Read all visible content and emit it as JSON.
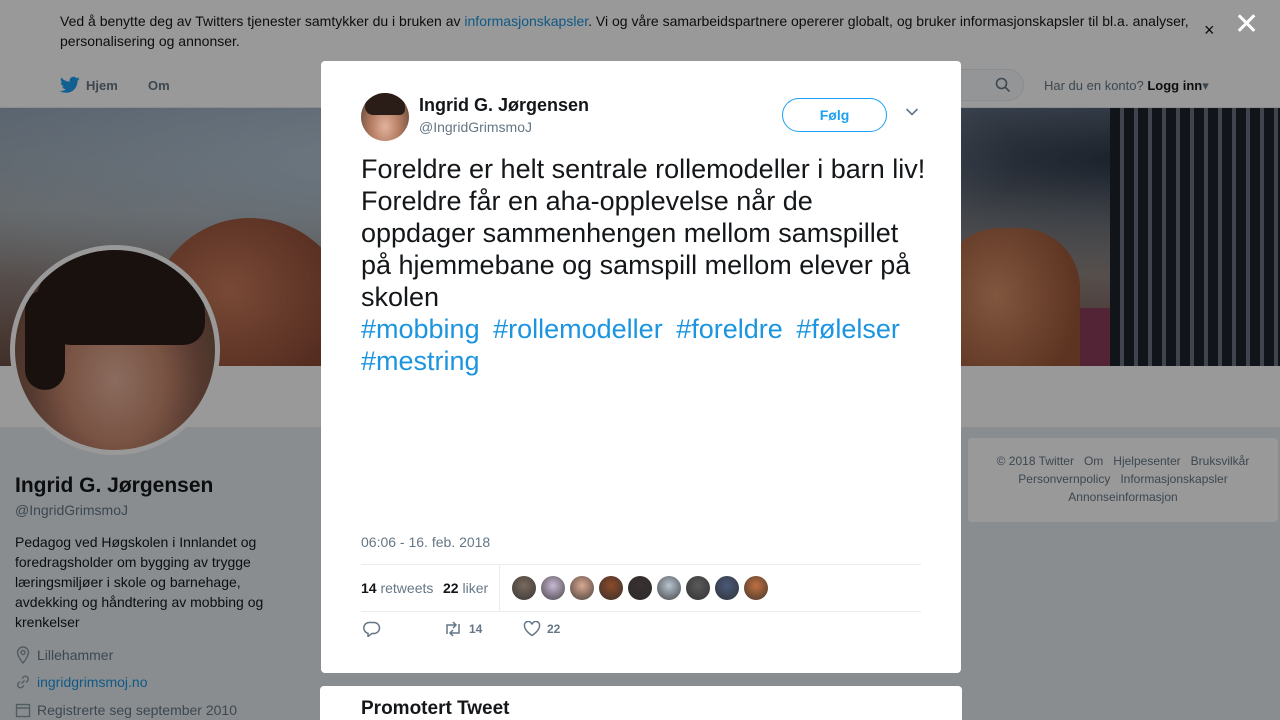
{
  "cookie": {
    "text_before": "Ved å benytte deg av Twitters tjenester samtykker du i bruken av ",
    "link": "informasjonskapsler",
    "text_after": ". Vi og våre samarbeidspartnere opererer globalt, og bruker informasjonskapsler til bl.a. analyser, personalisering og annonser.",
    "close": "×"
  },
  "nav": {
    "home": "Hjem",
    "about": "Om",
    "account_prompt": "Har du en konto?",
    "login": "Logg inn"
  },
  "profile": {
    "name": "Ingrid G. Jørgensen",
    "handle": "@IngridGrimsmoJ",
    "bio": "Pedagog ved Høgskolen i Innlandet og foredragsholder om bygging av trygge læringsmiljøer i skole og barnehage, avdekking og håndtering av mobbing og krenkelser",
    "location": "Lillehammer",
    "website": "ingridgrimsmoj.no",
    "joined": "Registrerte seg september 2010"
  },
  "footer": {
    "items": [
      "© 2018 Twitter",
      "Om",
      "Hjelpesenter",
      "Bruksvilkår",
      "Personvernpolicy",
      "Informasjonskapsler",
      "Annonseinformasjon"
    ]
  },
  "modal": {
    "name": "Ingrid G. Jørgensen",
    "handle": "@IngridGrimsmoJ",
    "follow": "Følg",
    "text": "Foreldre er helt sentrale rollemodeller i barn liv! Foreldre får en aha-opplevelse når de oppdager sammenhengen mellom samspillet på hjemmebane og samspill mellom elever på skolen",
    "hashtags": [
      "#mobbing",
      "#rollemodeller",
      "#foreldre",
      "#følelser",
      "#mestring"
    ],
    "timestamp": "06:06 - 16. feb. 2018",
    "retweets_count": "14",
    "retweets_label": "retweets",
    "likes_count": "22",
    "likes_label": "liker",
    "action_retweets": "14",
    "action_likes": "22",
    "liker_colors": [
      "#7a6a5e",
      "#c9b9d4",
      "#d9a890",
      "#8a4a2a",
      "#3a3030",
      "#b8c4d0",
      "#5a5a5a",
      "#4a5a7a",
      "#c07040"
    ]
  },
  "overlay": {
    "close": "✕"
  },
  "promo": {
    "title": "Promotert Tweet"
  },
  "colors": {
    "accent": "#1da1f2",
    "link": "#1b95e0",
    "muted": "#657786"
  }
}
